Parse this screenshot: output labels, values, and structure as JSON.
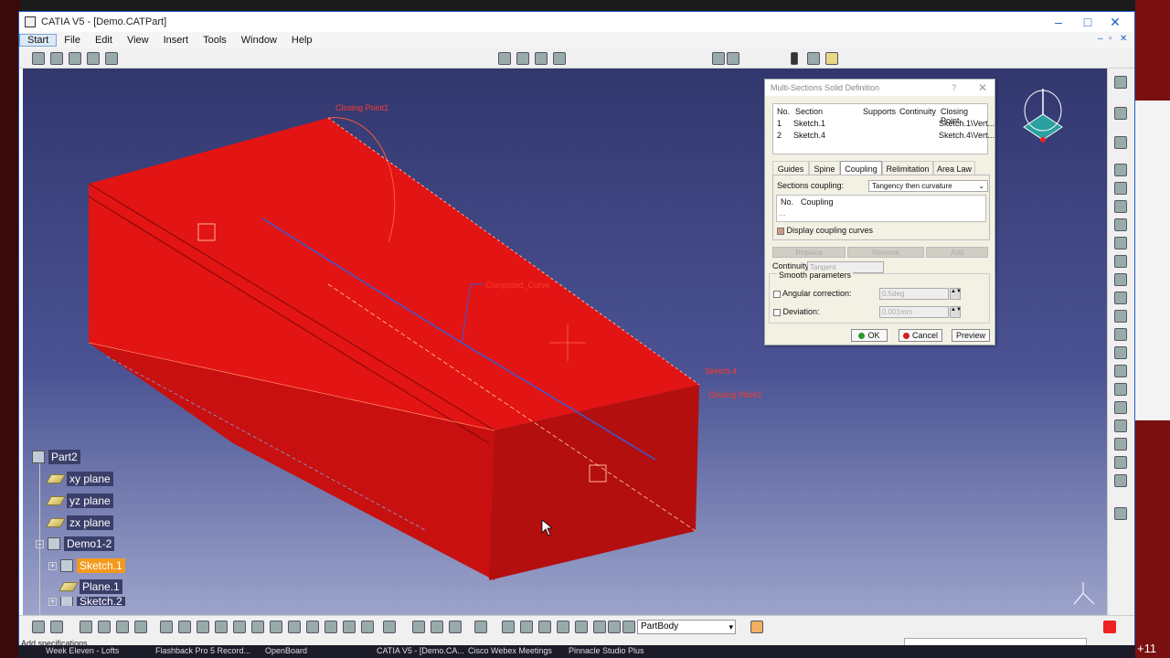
{
  "window": {
    "title": "CATIA V5 - [Demo.CATPart]",
    "minimize": "–",
    "maximize": "□",
    "close": "✕"
  },
  "menu": [
    "Start",
    "File",
    "Edit",
    "View",
    "Insert",
    "Tools",
    "Window",
    "Help"
  ],
  "tree": {
    "root": "Part2",
    "items": [
      {
        "label": "xy plane"
      },
      {
        "label": "yz plane"
      },
      {
        "label": "zx plane"
      },
      {
        "label": "Demo1-2"
      },
      {
        "label": "Sketch.1"
      },
      {
        "label": "Plane.1"
      },
      {
        "label": "Sketch.2"
      }
    ]
  },
  "viewport_labels": {
    "closing_point_top": "Closing Point1",
    "coupling_label": "Computed_Curve",
    "section_right": "Sketch.4",
    "closing_point_right": "Closing Point2"
  },
  "dialog": {
    "title": "Multi-Sections Solid Definition",
    "help": "?",
    "close": "✕",
    "headers": [
      "No.",
      "Section",
      "Supports",
      "Continuity",
      "Closing Point"
    ],
    "rows": [
      {
        "no": "1",
        "section": "Sketch.1",
        "closing": "Sketch.1\\Vert..."
      },
      {
        "no": "2",
        "section": "Sketch.4",
        "closing": "Sketch.4\\Vert..."
      }
    ],
    "tabs": [
      "Guides",
      "Spine",
      "Coupling",
      "Relimitation",
      "Area Law"
    ],
    "active_tab": "Coupling",
    "sections_coupling_label": "Sections coupling:",
    "sections_coupling_value": "Tangency then curvature",
    "coupling_headers": [
      "No.",
      "Coupling"
    ],
    "coupling_row": "...",
    "display_coupling": "Display coupling curves",
    "replace": "Replace",
    "remove": "Remove",
    "add": "Add",
    "continuity_label": "Continuity:",
    "continuity_value": "Tangent",
    "smooth_label": "Smooth parameters",
    "angular_label": "Angular correction:",
    "angular_value": "0.5deg",
    "deviation_label": "Deviation:",
    "deviation_value": "0.001mm",
    "ok": "OK",
    "cancel": "Cancel",
    "preview": "Preview"
  },
  "bottom": {
    "body_select": "PartBody",
    "status": "Add specifications"
  },
  "taskbar": [
    "Week Eleven - Lofts",
    "Flashback Pro 5 Record...",
    "OpenBoard",
    "CATIA V5 - [Demo.CA...",
    "Cisco Webex Meetings",
    "Pinnacle Studio Plus"
  ],
  "desktop": {
    "overflow_count": "+11"
  },
  "colors": {
    "solid_red": "#e31414",
    "solid_dark": "#b30f0f",
    "viewport_top": "#32376e",
    "viewport_bottom": "#9ea6cc",
    "selection_orange": "#f39a1e"
  }
}
